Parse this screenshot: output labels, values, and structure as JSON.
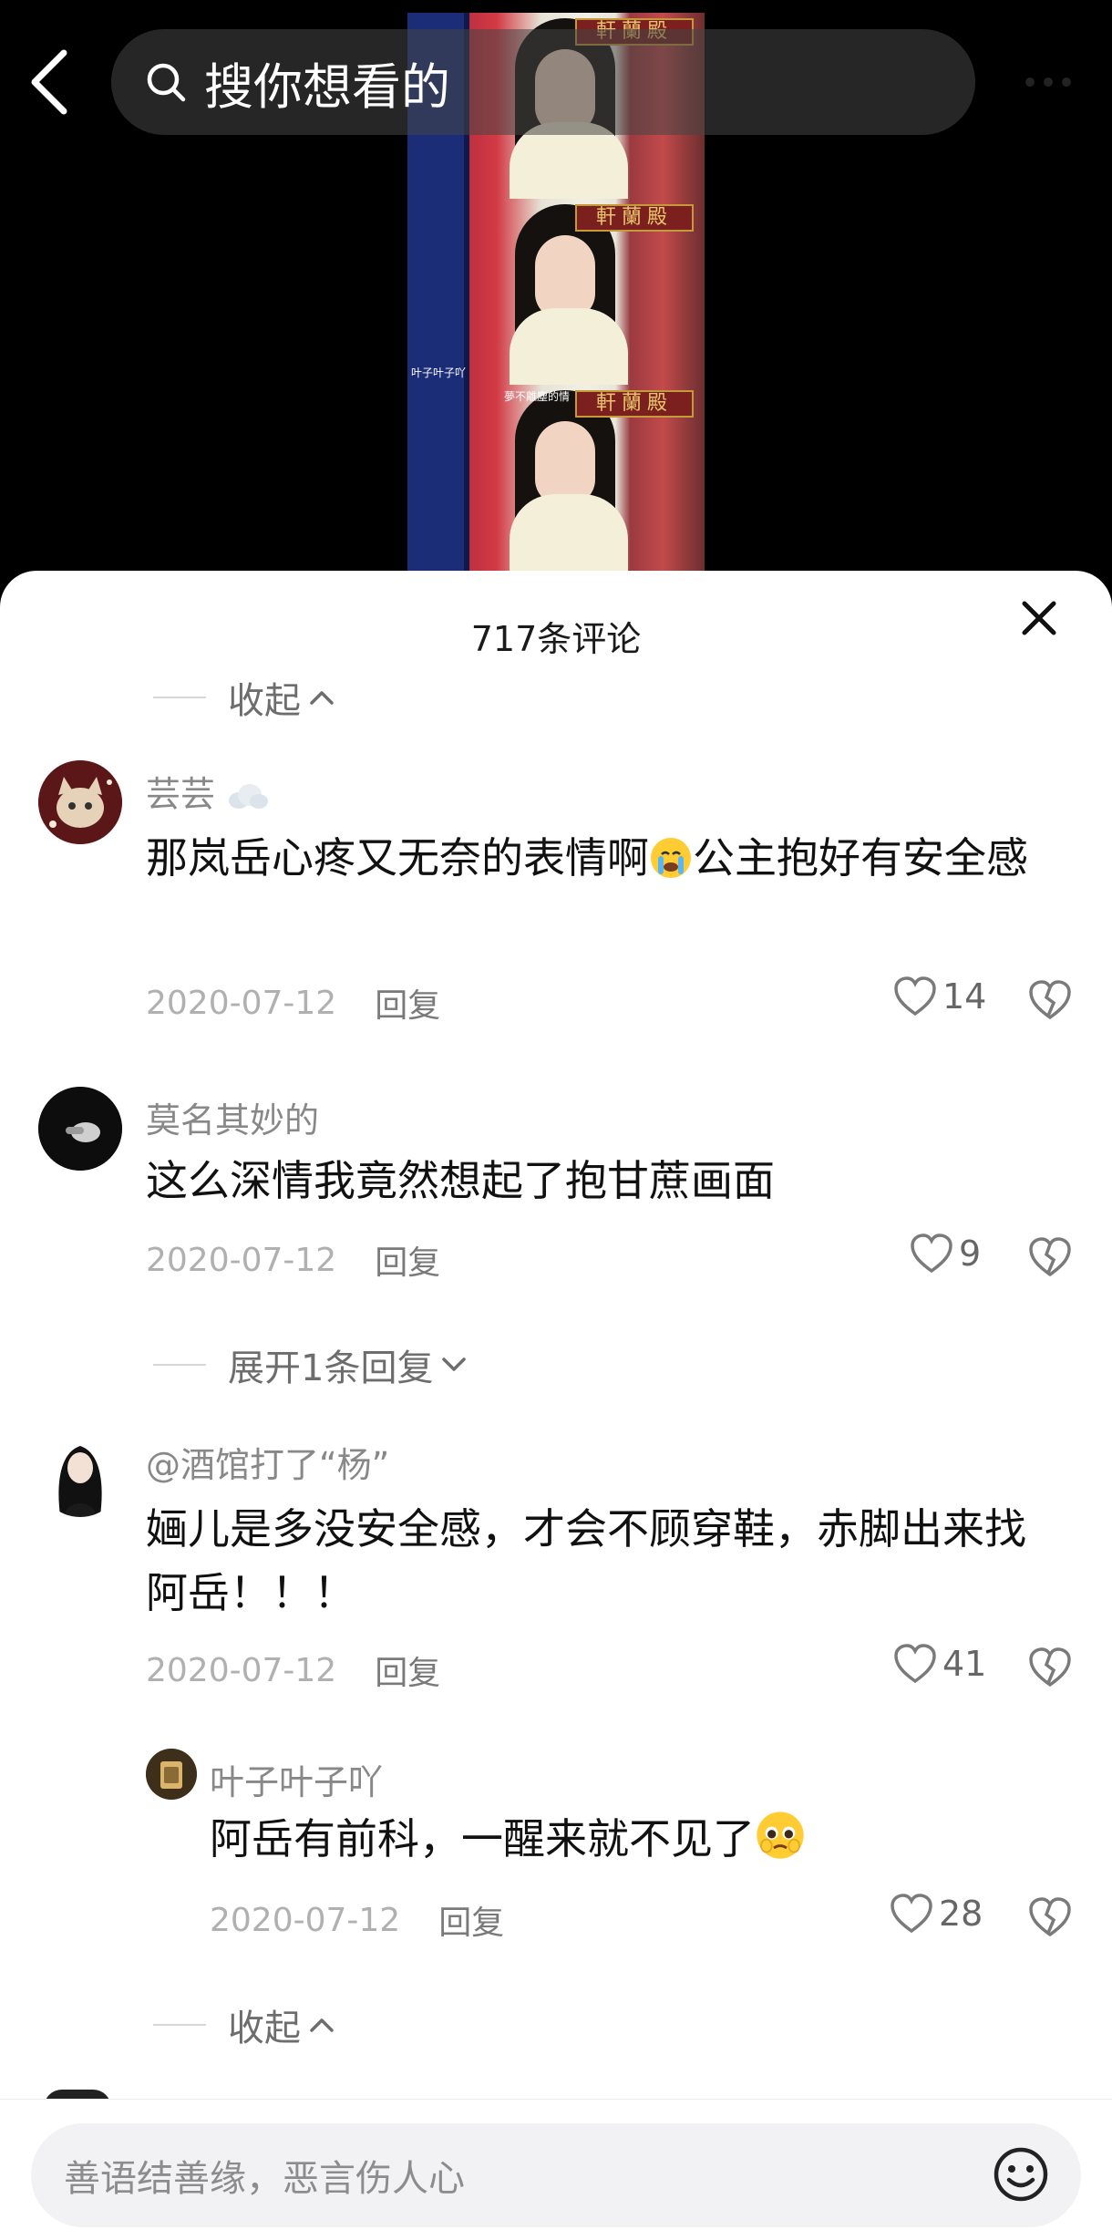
{
  "search": {
    "placeholder": "搜你想看的"
  },
  "video": {
    "sign_text": "軒蘭殿",
    "subtitle_1": "叶子叶子吖",
    "subtitle_2": "夢不離塵的情"
  },
  "comments_sheet": {
    "title": "717条评论",
    "collapse_label": "收起",
    "expand_label": "展开1条回复",
    "comments": [
      {
        "username": "芸芸",
        "text_parts": [
          "那岚岳心疼又无奈的表情啊",
          "公主抱好有安全感"
        ],
        "date": "2020-07-12",
        "reply": "回复",
        "likes": "14"
      },
      {
        "username": "莫名其妙的",
        "text": "这么深情我竟然想起了抱甘蔗画面",
        "date": "2020-07-12",
        "reply": "回复",
        "likes": "9"
      },
      {
        "username": "@酒馆打了“杨”",
        "text": "婳儿是多没安全感，才会不顾穿鞋，赤脚出来找阿岳！！！",
        "date": "2020-07-12",
        "reply": "回复",
        "likes": "41"
      },
      {
        "username": "叶子叶子吖",
        "text": "阿岳有前科，一醒来就不见了",
        "date": "2020-07-12",
        "reply": "回复",
        "likes": "28"
      }
    ]
  },
  "input": {
    "placeholder": "善语结善缘，恶言伤人心"
  },
  "colors": {
    "sheet_bg": "#ffffff",
    "muted_text": "#888888",
    "heart": "#7a7a7a"
  }
}
